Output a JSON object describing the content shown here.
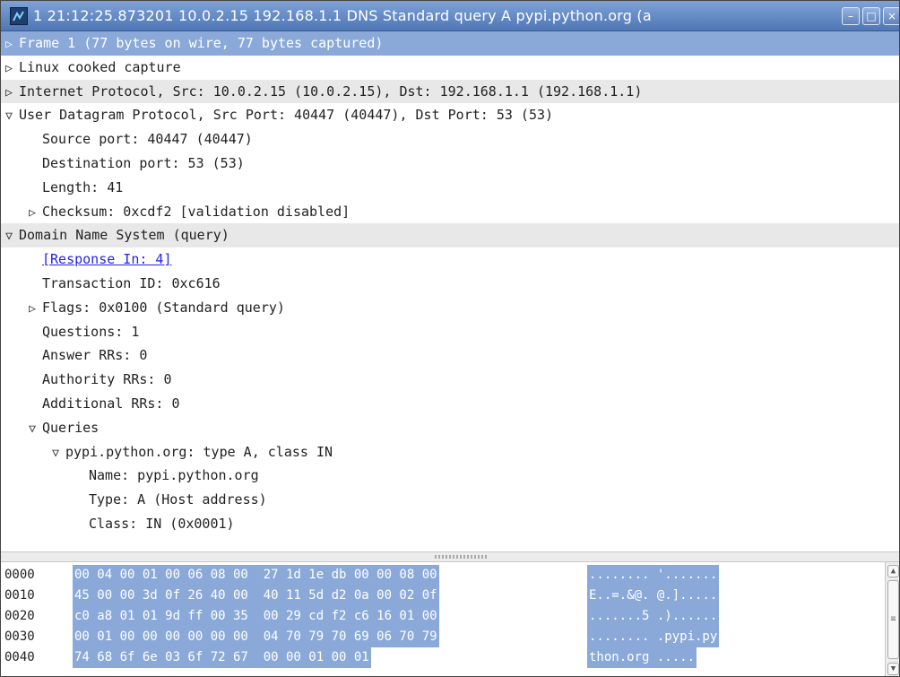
{
  "window": {
    "title": "1 21:12:25.873201 10.0.2.15 192.168.1.1 DNS Standard query A pypi.python.org  (a",
    "buttons": [
      "minimize",
      "maximize",
      "close"
    ]
  },
  "tree": {
    "rows": [
      {
        "indent": 0,
        "exp": "collapsed",
        "text": "Frame 1 (77 bytes on wire, 77 bytes captured)",
        "state": "selected"
      },
      {
        "indent": 0,
        "exp": "collapsed",
        "text": "Linux cooked capture",
        "state": ""
      },
      {
        "indent": 0,
        "exp": "collapsed",
        "text": "Internet Protocol, Src: 10.0.2.15 (10.0.2.15), Dst: 192.168.1.1 (192.168.1.1)",
        "state": "hl"
      },
      {
        "indent": 0,
        "exp": "expanded",
        "text": "User Datagram Protocol, Src Port: 40447 (40447), Dst Port: 53 (53)",
        "state": ""
      },
      {
        "indent": 1,
        "exp": "none",
        "text": "Source port: 40447 (40447)",
        "state": ""
      },
      {
        "indent": 1,
        "exp": "none",
        "text": "Destination port: 53 (53)",
        "state": ""
      },
      {
        "indent": 1,
        "exp": "none",
        "text": "Length: 41",
        "state": ""
      },
      {
        "indent": 1,
        "exp": "collapsed",
        "text": "Checksum: 0xcdf2 [validation disabled]",
        "state": ""
      },
      {
        "indent": 0,
        "exp": "expanded",
        "text": "Domain Name System (query)",
        "state": "hl"
      },
      {
        "indent": 1,
        "exp": "none",
        "text": "[Response In: 4]",
        "state": "link"
      },
      {
        "indent": 1,
        "exp": "none",
        "text": "Transaction ID: 0xc616",
        "state": ""
      },
      {
        "indent": 1,
        "exp": "collapsed",
        "text": "Flags: 0x0100 (Standard query)",
        "state": ""
      },
      {
        "indent": 1,
        "exp": "none",
        "text": "Questions: 1",
        "state": ""
      },
      {
        "indent": 1,
        "exp": "none",
        "text": "Answer RRs: 0",
        "state": ""
      },
      {
        "indent": 1,
        "exp": "none",
        "text": "Authority RRs: 0",
        "state": ""
      },
      {
        "indent": 1,
        "exp": "none",
        "text": "Additional RRs: 0",
        "state": ""
      },
      {
        "indent": 1,
        "exp": "expanded",
        "text": "Queries",
        "state": ""
      },
      {
        "indent": 2,
        "exp": "expanded",
        "text": "pypi.python.org: type A, class IN",
        "state": ""
      },
      {
        "indent": 3,
        "exp": "none",
        "text": "Name: pypi.python.org",
        "state": ""
      },
      {
        "indent": 3,
        "exp": "none",
        "text": "Type: A (Host address)",
        "state": ""
      },
      {
        "indent": 3,
        "exp": "none",
        "text": "Class: IN (0x0001)",
        "state": ""
      }
    ]
  },
  "hex": {
    "rows": [
      {
        "offset": "0000",
        "bytes": "00 04 00 01 00 06 08 00  27 1d 1e db 00 00 08 00",
        "ascii": "........ '......."
      },
      {
        "offset": "0010",
        "bytes": "45 00 00 3d 0f 26 40 00  40 11 5d d2 0a 00 02 0f",
        "ascii": "E..=.&@. @.]....."
      },
      {
        "offset": "0020",
        "bytes": "c0 a8 01 01 9d ff 00 35  00 29 cd f2 c6 16 01 00",
        "ascii": ".......5 .)......"
      },
      {
        "offset": "0030",
        "bytes": "00 01 00 00 00 00 00 00  04 70 79 70 69 06 70 79",
        "ascii": "........ .pypi.py"
      },
      {
        "offset": "0040",
        "bytes": "74 68 6f 6e 03 6f 72 67  00 00 01 00 01",
        "ascii": "thon.org ....."
      }
    ]
  },
  "colors": {
    "selection": "#8aa9d9",
    "title_bar": "#5f86c4",
    "highlight_row": "#e8e8e8",
    "link": "#2222ee"
  }
}
